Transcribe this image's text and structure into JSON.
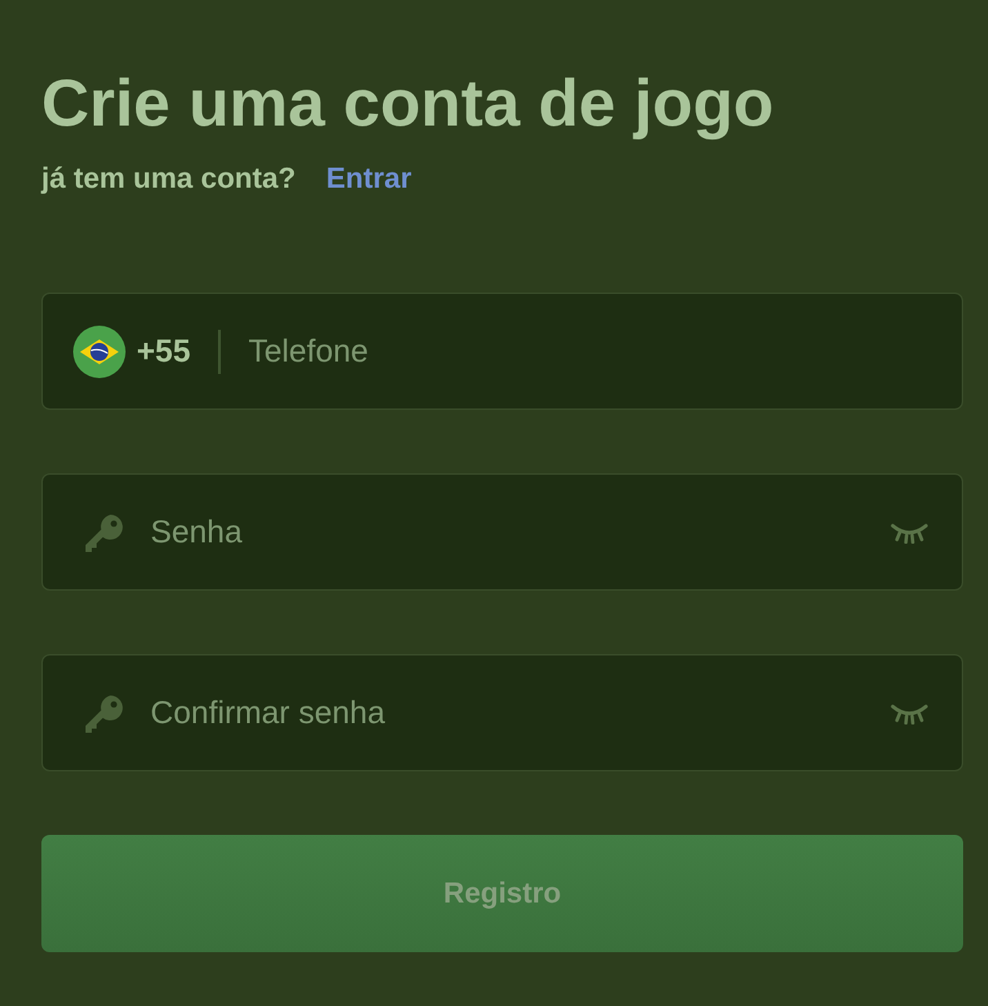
{
  "title": "Crie uma conta de jogo",
  "subtitle": {
    "text": "já tem uma conta?",
    "link": "Entrar"
  },
  "fields": [
    {
      "kind": "phone",
      "prefix": "+55",
      "placeholder": "Telefone"
    },
    {
      "kind": "password",
      "placeholder": "Senha"
    },
    {
      "kind": "password",
      "placeholder": "Confirmar senha"
    }
  ],
  "submit": {
    "label": "Registro",
    "disabled": true
  }
}
